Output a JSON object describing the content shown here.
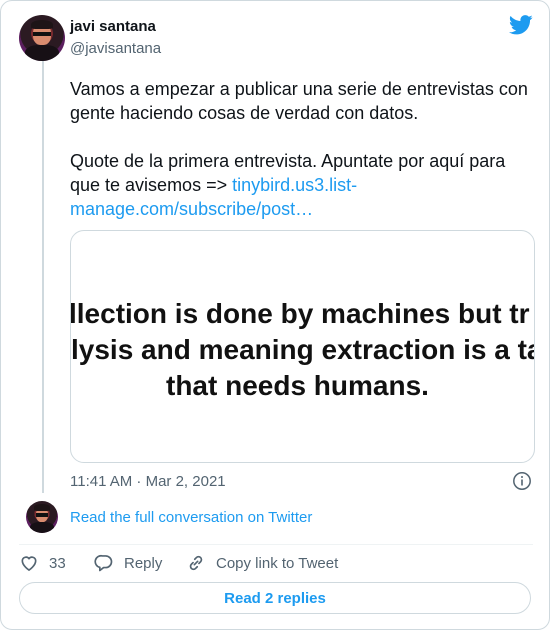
{
  "author": {
    "name": "javi santana",
    "handle": "@javisantana"
  },
  "tweet": {
    "paragraph1": "Vamos a empezar a publicar una serie de entrevistas con gente haciendo cosas de verdad con datos.",
    "paragraph2_text": "Quote de la primera entrevista. Apuntate por aquí para que te avisemos => ",
    "link_text": "tinybird.us3.list-manage.com/subscribe/post…"
  },
  "media": {
    "line1": "llection is done by machines but tr",
    "line2": "lysis and meaning extraction is a ta",
    "line3": "that needs humans."
  },
  "timestamp": "11:41 AM · Mar 2, 2021",
  "read_conversation": "Read the full conversation on Twitter",
  "actions": {
    "likes_count": "33",
    "reply_label": "Reply",
    "copy_link_label": "Copy link to Tweet"
  },
  "replies_button": "Read 2 replies",
  "colors": {
    "accent": "#1d9bf0",
    "text": "#0f1419",
    "muted": "#536471",
    "border": "#cfd9de"
  },
  "icons": [
    "twitter-bird-icon",
    "info-icon",
    "heart-icon",
    "reply-icon",
    "link-icon"
  ]
}
